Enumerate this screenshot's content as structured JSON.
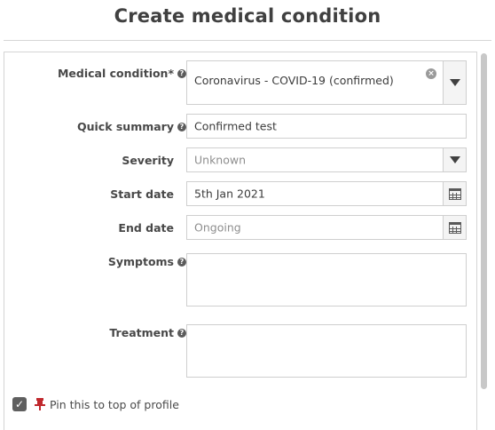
{
  "header": {
    "title": "Create medical condition"
  },
  "form": {
    "medical_condition": {
      "label": "Medical condition*",
      "value": "Coronavirus - COVID-19 (confirmed)"
    },
    "quick_summary": {
      "label": "Quick summary",
      "value": "Confirmed test"
    },
    "severity": {
      "label": "Severity",
      "placeholder": "Unknown"
    },
    "start_date": {
      "label": "Start date",
      "value": "5th Jan 2021"
    },
    "end_date": {
      "label": "End date",
      "placeholder": "Ongoing"
    },
    "symptoms": {
      "label": "Symptoms",
      "value": ""
    },
    "treatment": {
      "label": "Treatment",
      "value": ""
    },
    "pin": {
      "label": "Pin this to top of profile",
      "checked": true
    }
  },
  "icons": {
    "help": "question-circle-icon",
    "clear": "clear-x-icon",
    "dropdown": "caret-down-icon",
    "calendar": "calendar-icon",
    "pin": "thumbtack-icon",
    "check": "check-icon"
  },
  "colors": {
    "pin": "#c0282d",
    "checkbox": "#5f5f5f",
    "help": "#5b5b5b"
  }
}
